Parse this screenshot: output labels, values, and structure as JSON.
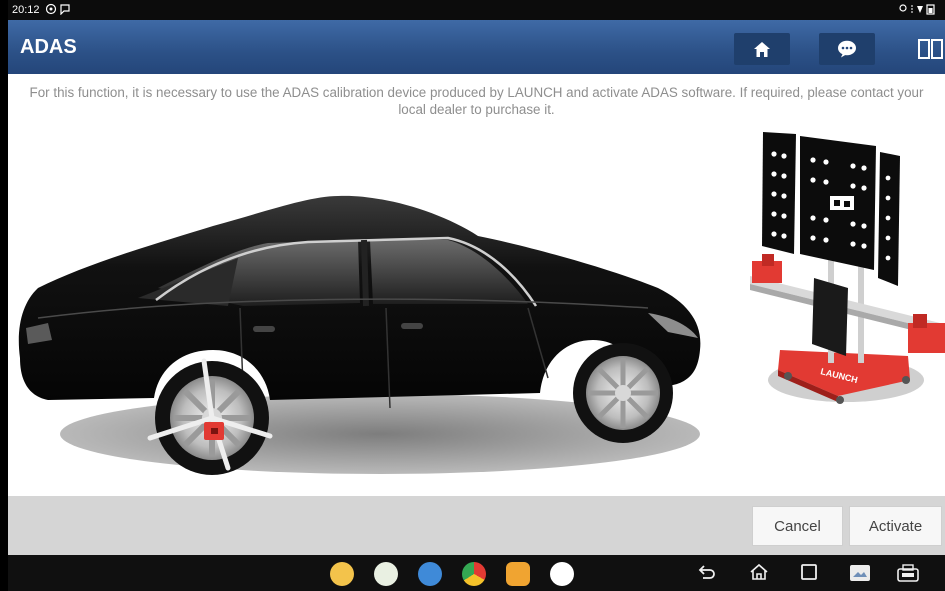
{
  "status_bar": {
    "time": "20:12"
  },
  "app_bar": {
    "title": "ADAS"
  },
  "notice": "For this function, it is necessary to use the ADAS calibration device produced by LAUNCH and activate ADAS software. If required, please contact your local dealer to purchase it.",
  "device_brand": "LAUNCH",
  "actions": {
    "cancel_label": "Cancel",
    "activate_label": "Activate"
  },
  "icons": {
    "home": "home-icon",
    "message": "chat-icon",
    "layout": "split-view-icon",
    "back": "back-icon",
    "nav_home": "house-icon",
    "recents": "recents-icon"
  },
  "colors": {
    "app_bar": "#2c5187",
    "action_bar": "#d5d5d5",
    "accent_red": "#e23a33"
  }
}
